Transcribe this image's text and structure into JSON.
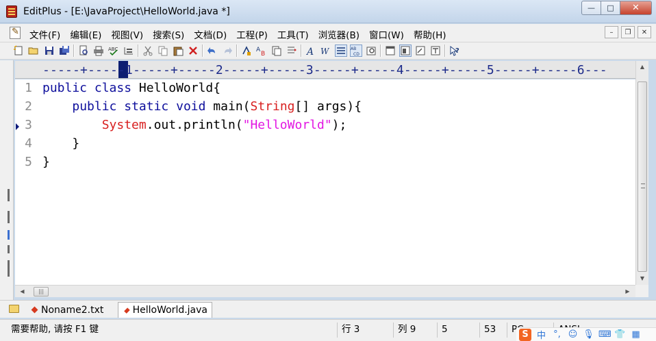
{
  "window": {
    "title": "EditPlus - [E:\\JavaProject\\HelloWorld.java *]",
    "controls": {
      "minimize": "—",
      "maximize": "□",
      "close": "✕"
    }
  },
  "menu": {
    "items": [
      "文件(F)",
      "编辑(E)",
      "视图(V)",
      "搜索(S)",
      "文档(D)",
      "工程(P)",
      "工具(T)",
      "浏览器(B)",
      "窗口(W)",
      "帮助(H)"
    ],
    "mdi_controls": {
      "minimize": "–",
      "restore": "❐",
      "close": "✕"
    }
  },
  "ruler": {
    "text": "-----+-----1-----+-----2-----+-----3-----+-----4-----+-----5-----+-----6---"
  },
  "editor": {
    "current_line": 3,
    "lines": [
      {
        "number": "1",
        "tokens": [
          {
            "t": "public",
            "c": "kw"
          },
          {
            "t": " ",
            "c": "pl"
          },
          {
            "t": "class",
            "c": "kw"
          },
          {
            "t": " HelloWorld{",
            "c": "pl"
          }
        ]
      },
      {
        "number": "2",
        "tokens": [
          {
            "t": "    ",
            "c": "pl"
          },
          {
            "t": "public",
            "c": "kw"
          },
          {
            "t": " ",
            "c": "pl"
          },
          {
            "t": "static",
            "c": "kw"
          },
          {
            "t": " ",
            "c": "pl"
          },
          {
            "t": "void",
            "c": "kw"
          },
          {
            "t": " main(",
            "c": "pl"
          },
          {
            "t": "String",
            "c": "ty"
          },
          {
            "t": "[] args){",
            "c": "pl"
          }
        ]
      },
      {
        "number": "3",
        "tokens": [
          {
            "t": "        ",
            "c": "pl"
          },
          {
            "t": "System",
            "c": "ty"
          },
          {
            "t": ".out.println(",
            "c": "pl"
          },
          {
            "t": "\"HelloWorld\"",
            "c": "st"
          },
          {
            "t": ");",
            "c": "pl"
          }
        ]
      },
      {
        "number": "4",
        "tokens": [
          {
            "t": "    }",
            "c": "pl"
          }
        ]
      },
      {
        "number": "5",
        "tokens": [
          {
            "t": "}",
            "c": "pl"
          }
        ]
      }
    ],
    "colors": {
      "keyword": "#0e0f9c",
      "type": "#d81f1f",
      "string": "#e216e2",
      "line_number": "#8c8c8c"
    }
  },
  "tabs": [
    {
      "label": "Noname2.txt",
      "active": false
    },
    {
      "label": "HelloWorld.java",
      "active": true
    }
  ],
  "status": {
    "help": "需要帮助, 请按 F1 键",
    "line": "行 3",
    "col": "列 9",
    "field3": "5",
    "field4": "53",
    "field5": "PC",
    "encoding": "ANSI"
  },
  "ime": {
    "logo": "S",
    "items": [
      "中",
      "°,",
      "☺",
      "🎙",
      "⌨",
      "👕",
      "▦"
    ]
  }
}
